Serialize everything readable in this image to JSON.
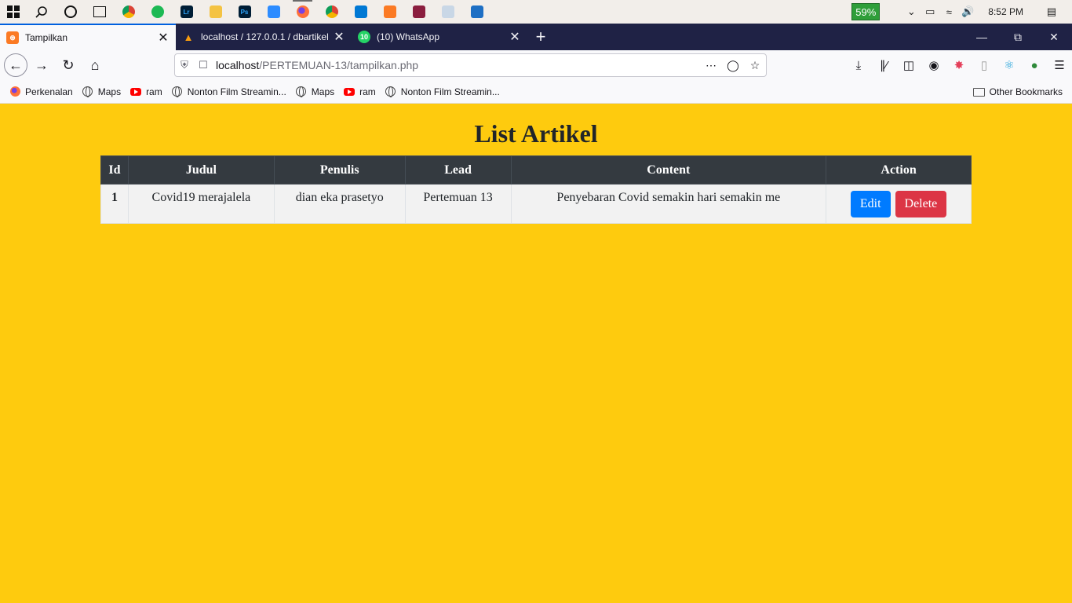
{
  "taskbar": {
    "battery": "59%",
    "clock": "8:52 PM"
  },
  "tabs": [
    {
      "title": "Tampilkan",
      "active": true
    },
    {
      "title": "localhost / 127.0.0.1 / dbartikel",
      "active": false
    },
    {
      "title": "(10) WhatsApp",
      "active": false
    }
  ],
  "navbar": {
    "url_host": "localhost",
    "url_path": "/PERTEMUAN-13/tampilkan.php"
  },
  "bookmarks": {
    "items": [
      "Perkenalan",
      "Maps",
      "ram",
      "Nonton Film Streamin...",
      "Maps",
      "ram",
      "Nonton Film Streamin..."
    ],
    "other": "Other Bookmarks"
  },
  "page": {
    "title": "List Artikel",
    "columns": [
      "Id",
      "Judul",
      "Penulis",
      "Lead",
      "Content",
      "Action"
    ],
    "rows": [
      {
        "id": "1",
        "judul": "Covid19 merajalela",
        "penulis": "dian eka prasetyo",
        "lead": "Pertemuan 13",
        "content": "Penyebaran Covid semakin hari semakin me",
        "edit_label": "Edit",
        "delete_label": "Delete"
      }
    ]
  },
  "colors": {
    "page_bg": "#fecb0e",
    "table_header": "#343a40",
    "edit_button": "#007bff",
    "delete_button": "#dc3545"
  }
}
